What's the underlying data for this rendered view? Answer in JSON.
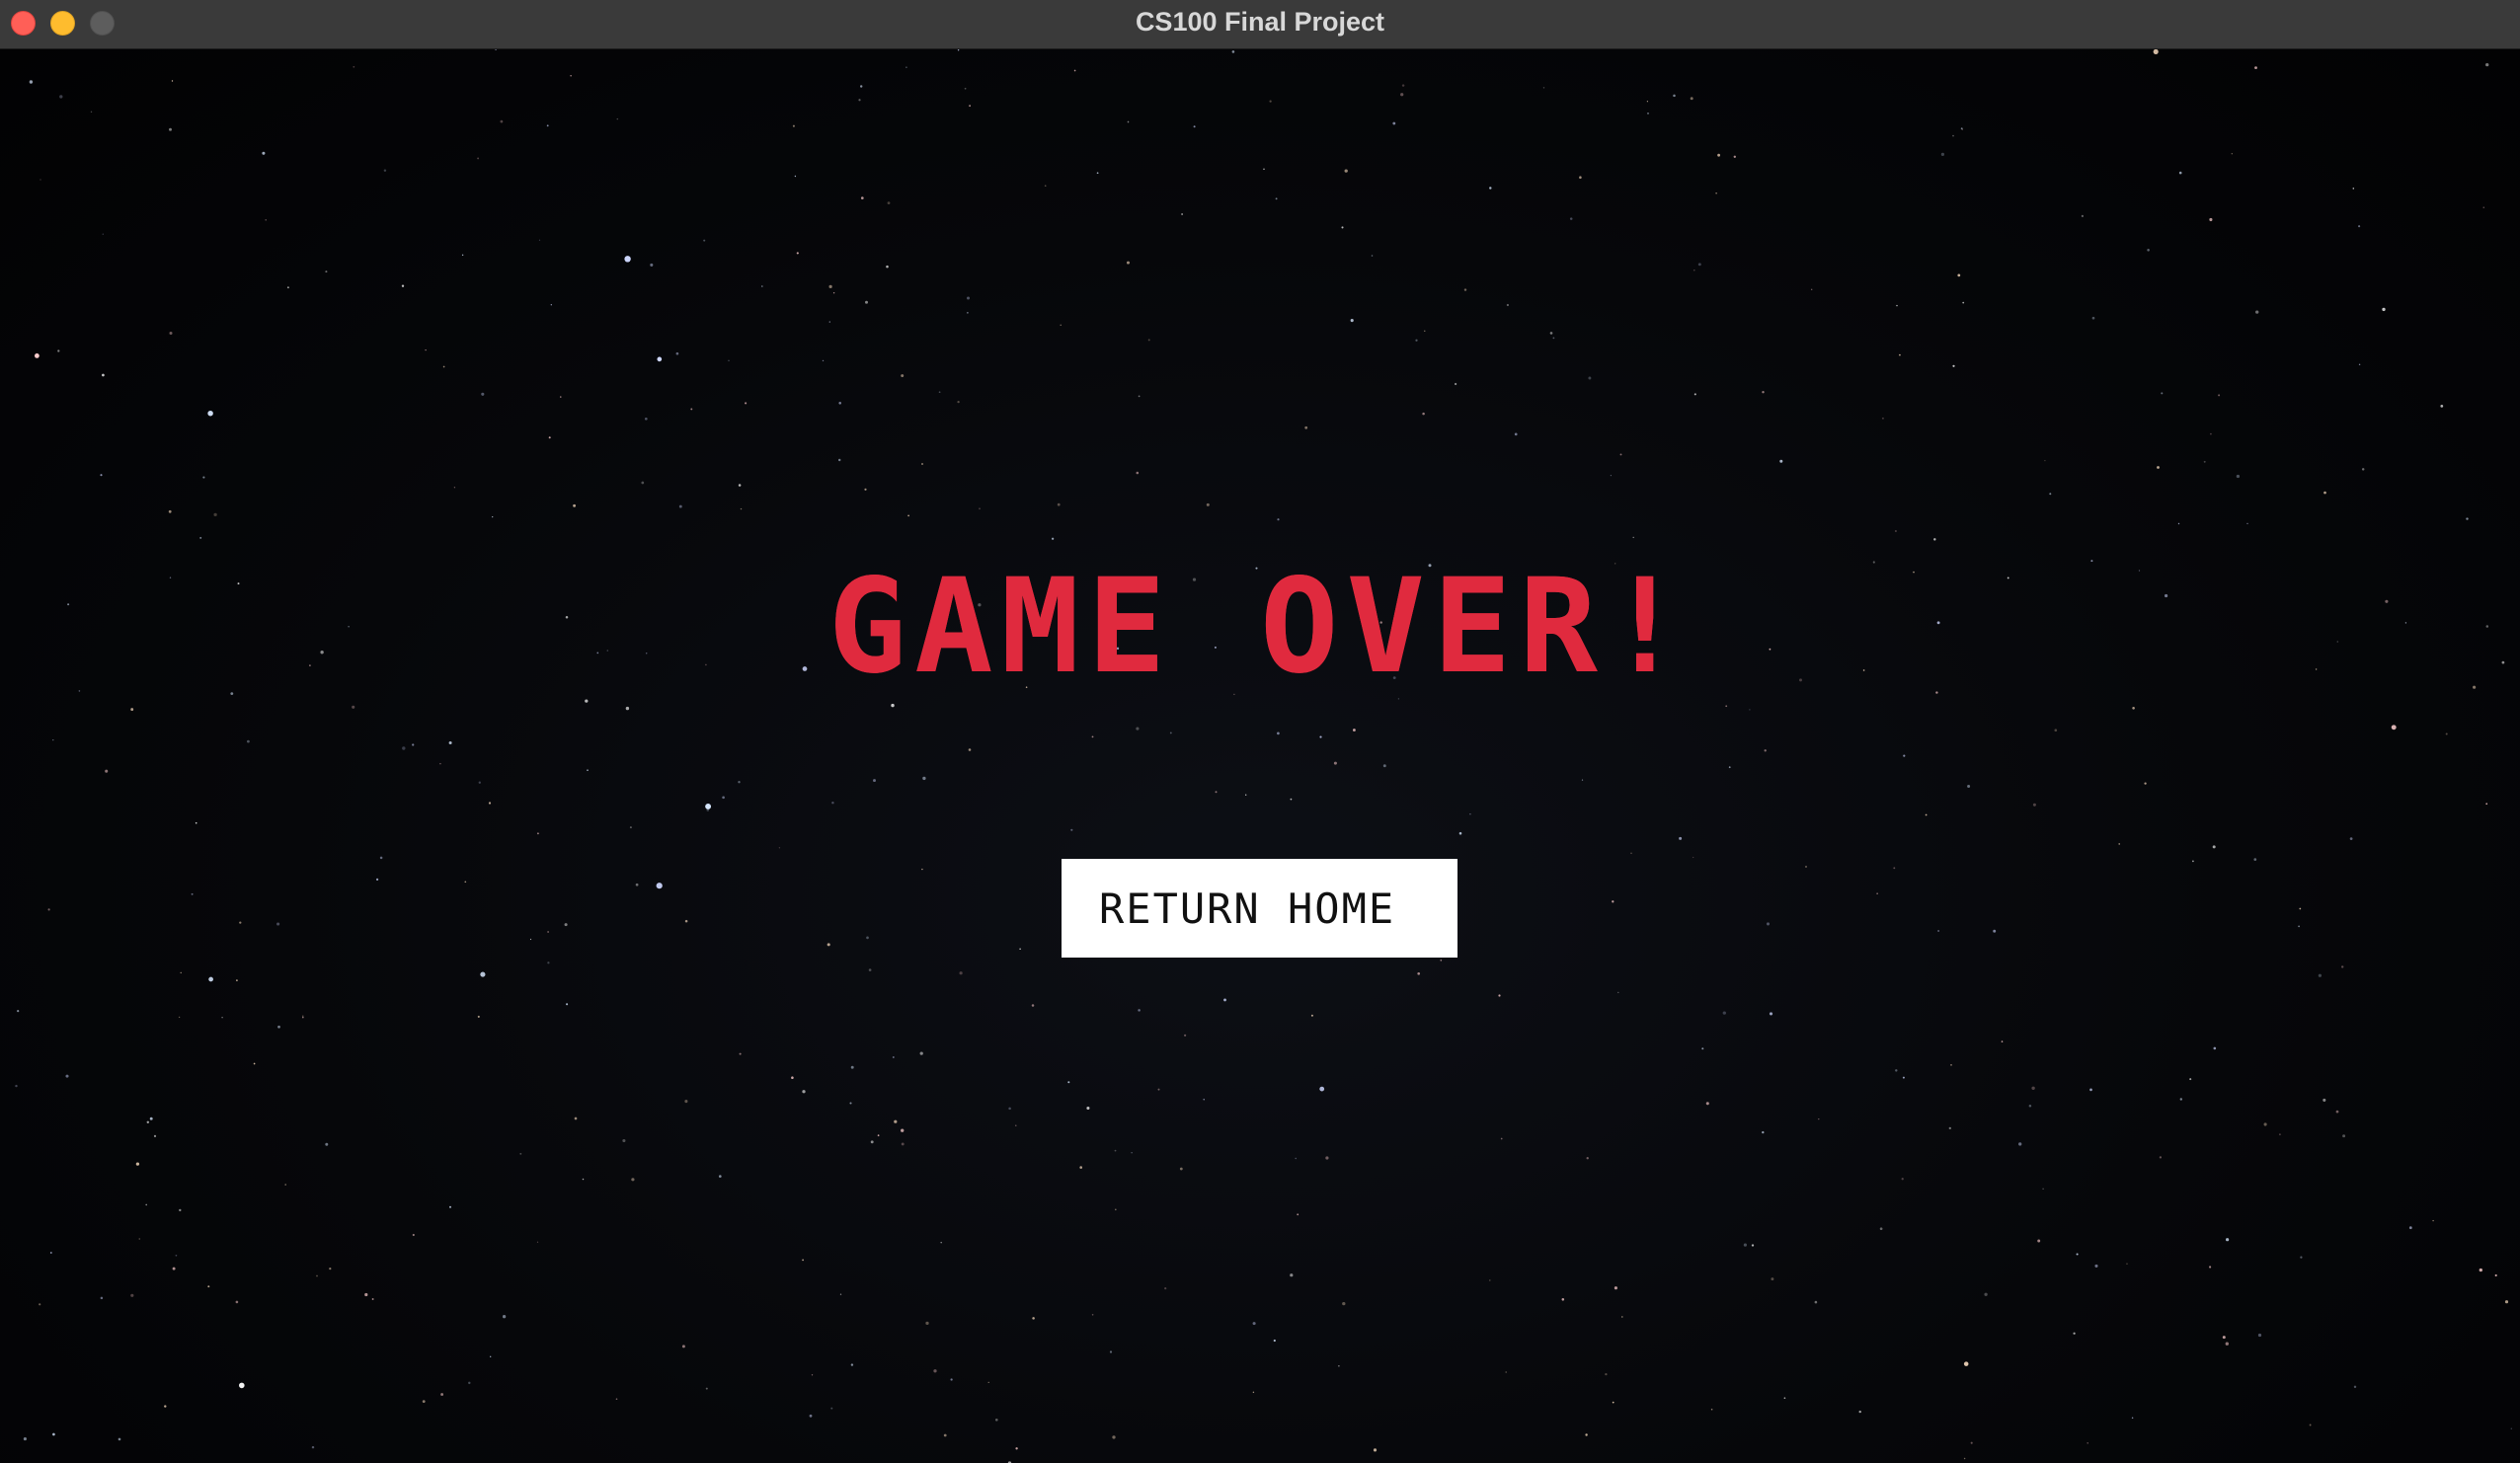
{
  "window": {
    "title": "CS100 Final Project"
  },
  "game": {
    "heading": "GAME OVER!",
    "return_button_label": "RETURN HOME"
  },
  "colors": {
    "heading": "#e02a3e",
    "button_background": "#ffffff",
    "background": "#000000"
  },
  "icons": {
    "close": "close-icon",
    "minimize": "minimize-icon",
    "zoom": "zoom-icon"
  }
}
